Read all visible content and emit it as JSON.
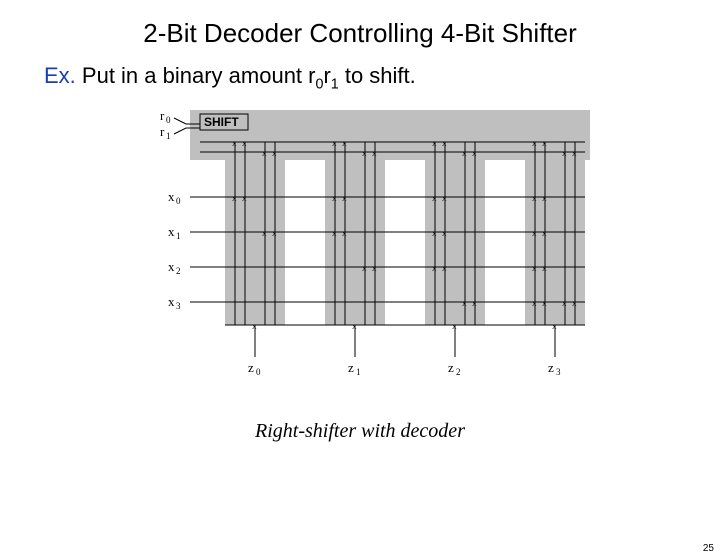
{
  "title": "2-Bit Decoder Controlling 4-Bit Shifter",
  "example": {
    "prefix": "Ex.",
    "text_before": " Put in a binary amount  r",
    "sub0": "0",
    "mid": "r",
    "sub1": "1",
    "text_after": " to shift."
  },
  "caption": "Right-shifter with decoder",
  "page_number": "25",
  "diagram": {
    "shift_label": "SHIFT",
    "control_inputs": [
      "r0",
      "r1"
    ],
    "data_inputs": [
      "x0",
      "x1",
      "x2",
      "x3"
    ],
    "outputs": [
      "z0",
      "z1",
      "z2",
      "z3"
    ]
  }
}
